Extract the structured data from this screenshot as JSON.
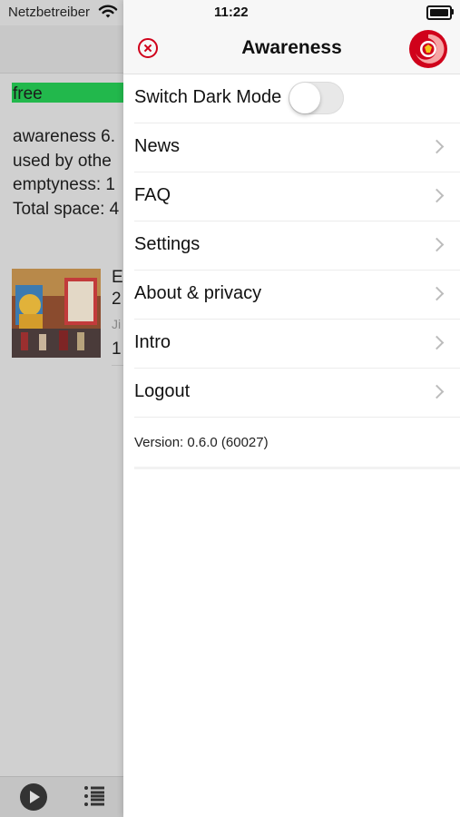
{
  "status_bar": {
    "carrier": "Netzbetreiber",
    "time": "11:22"
  },
  "background": {
    "free_label": "free",
    "storage_lines": [
      "awareness 6.",
      "used by othe",
      "emptyness: 1",
      "Total space: 4"
    ],
    "item": {
      "title_line1": "E",
      "title_line2": "2",
      "subtitle": "Ji",
      "number": "1"
    }
  },
  "drawer": {
    "title": "Awareness",
    "menu": {
      "dark_mode_label": "Switch Dark Mode",
      "dark_mode_on": false,
      "items": [
        {
          "label": "News"
        },
        {
          "label": "FAQ"
        },
        {
          "label": "Settings"
        },
        {
          "label": "About & privacy"
        },
        {
          "label": "Intro"
        },
        {
          "label": "Logout"
        }
      ]
    },
    "version": "Version: 0.6.0 (60027)"
  },
  "colors": {
    "accent": "#d0021b",
    "free_bar": "#22b84c"
  },
  "icons": [
    "wifi-icon",
    "battery-icon",
    "close-icon",
    "app-logo-icon",
    "chevron-right-icon",
    "play-icon",
    "list-icon"
  ]
}
